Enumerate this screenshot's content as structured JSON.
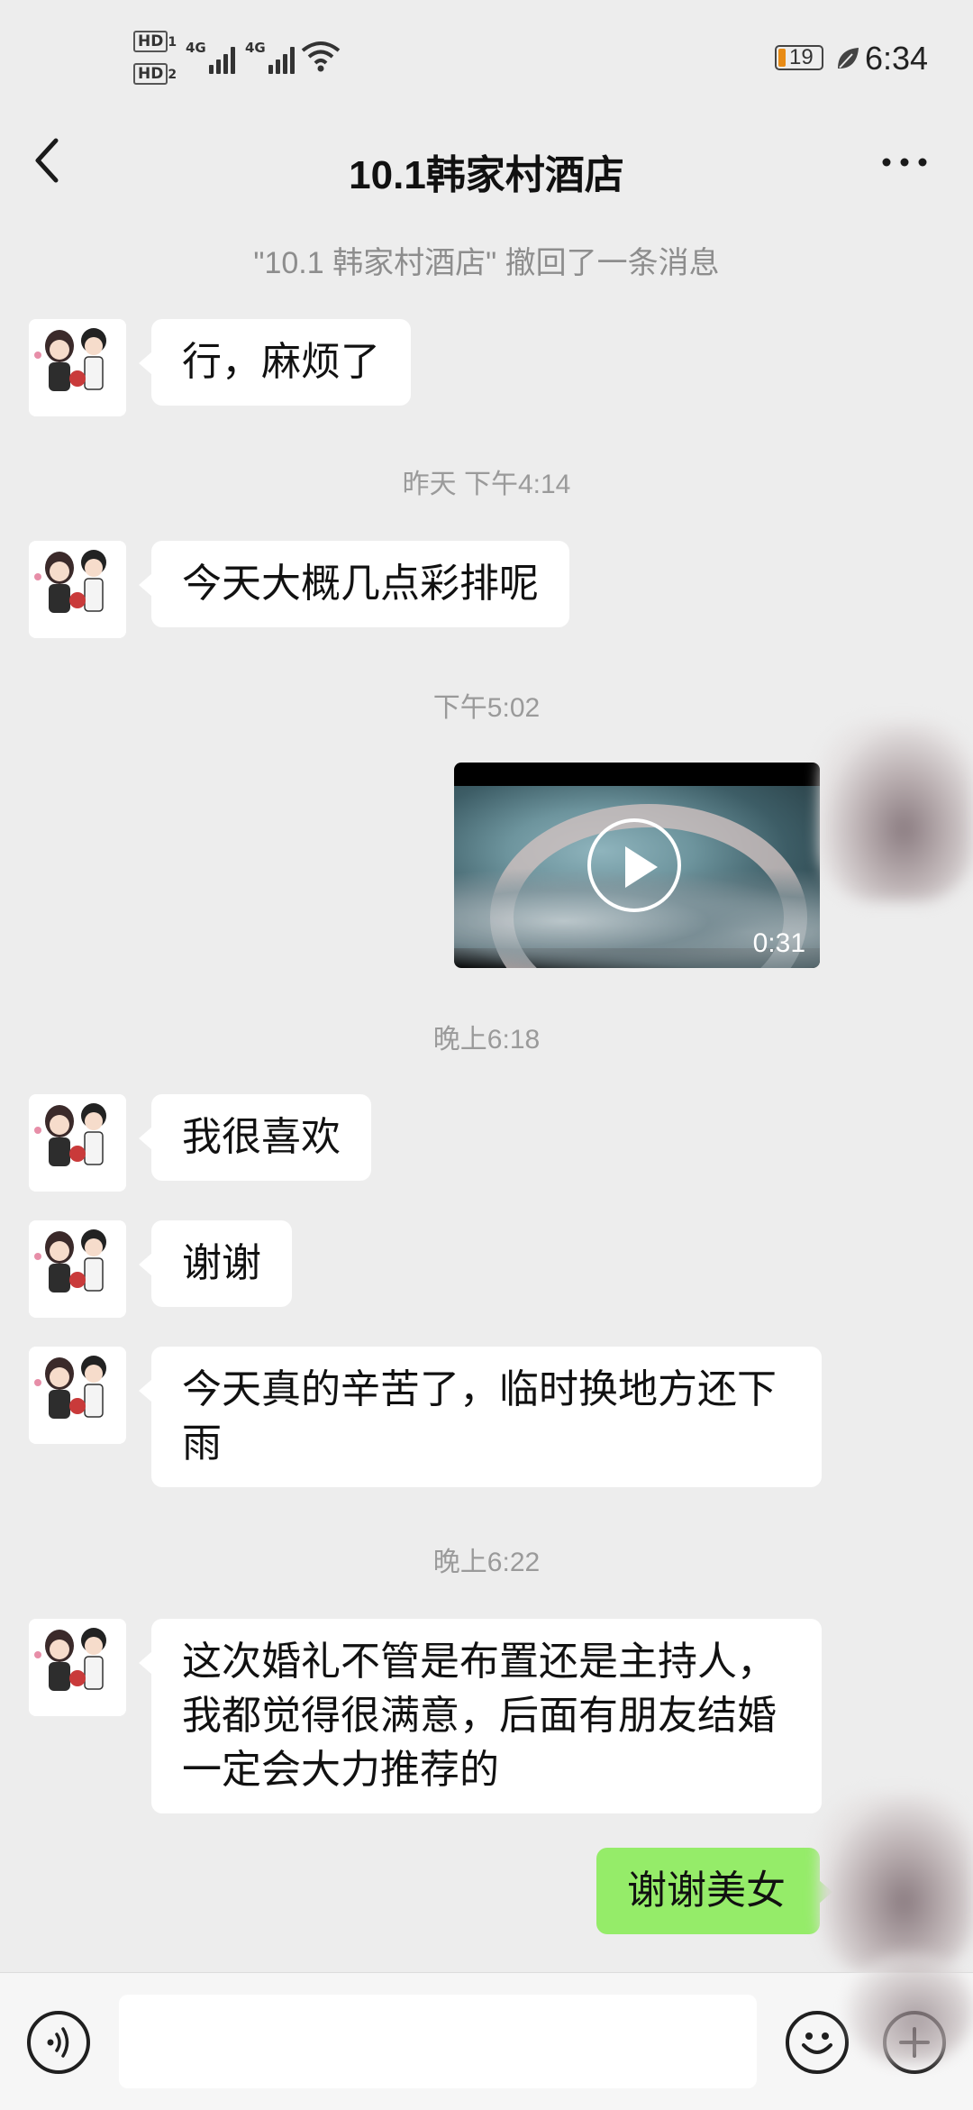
{
  "status_bar": {
    "hd1": "HD",
    "hd2": "HD",
    "sim1": "1",
    "sim2": "2",
    "net1": "4G",
    "net2": "4G",
    "battery": "19",
    "time": "6:34"
  },
  "header": {
    "title": "10.1韩家村酒店",
    "back_icon": "chevron-left-icon",
    "more_icon": "more-horizontal-icon"
  },
  "system_note": "\"10.1 韩家村酒店\" 撤回了一条消息",
  "messages": [
    {
      "text": "行，麻烦了"
    },
    {
      "timestamp": "昨天 下午4:14"
    },
    {
      "text": "今天大概几点彩排呢"
    },
    {
      "timestamp": "下午5:02"
    },
    {
      "video_duration": "0:31"
    },
    {
      "timestamp": "晚上6:18"
    },
    {
      "text": "我很喜欢"
    },
    {
      "text": "谢谢"
    },
    {
      "text": "今天真的辛苦了，临时换地方还下雨"
    },
    {
      "timestamp": "晚上6:22"
    },
    {
      "text": "这次婚礼不管是布置还是主持人，我都觉得很满意，后面有朋友结婚一定会大力推荐的"
    },
    {
      "text": "谢谢美女"
    }
  ],
  "input_bar": {
    "voice_icon": "voice-icon",
    "emoji_icon": "emoji-icon",
    "plus_icon": "plus-icon"
  },
  "colors": {
    "background": "#ededed",
    "incoming_bubble": "#ffffff",
    "outgoing_bubble": "#95ec69"
  }
}
